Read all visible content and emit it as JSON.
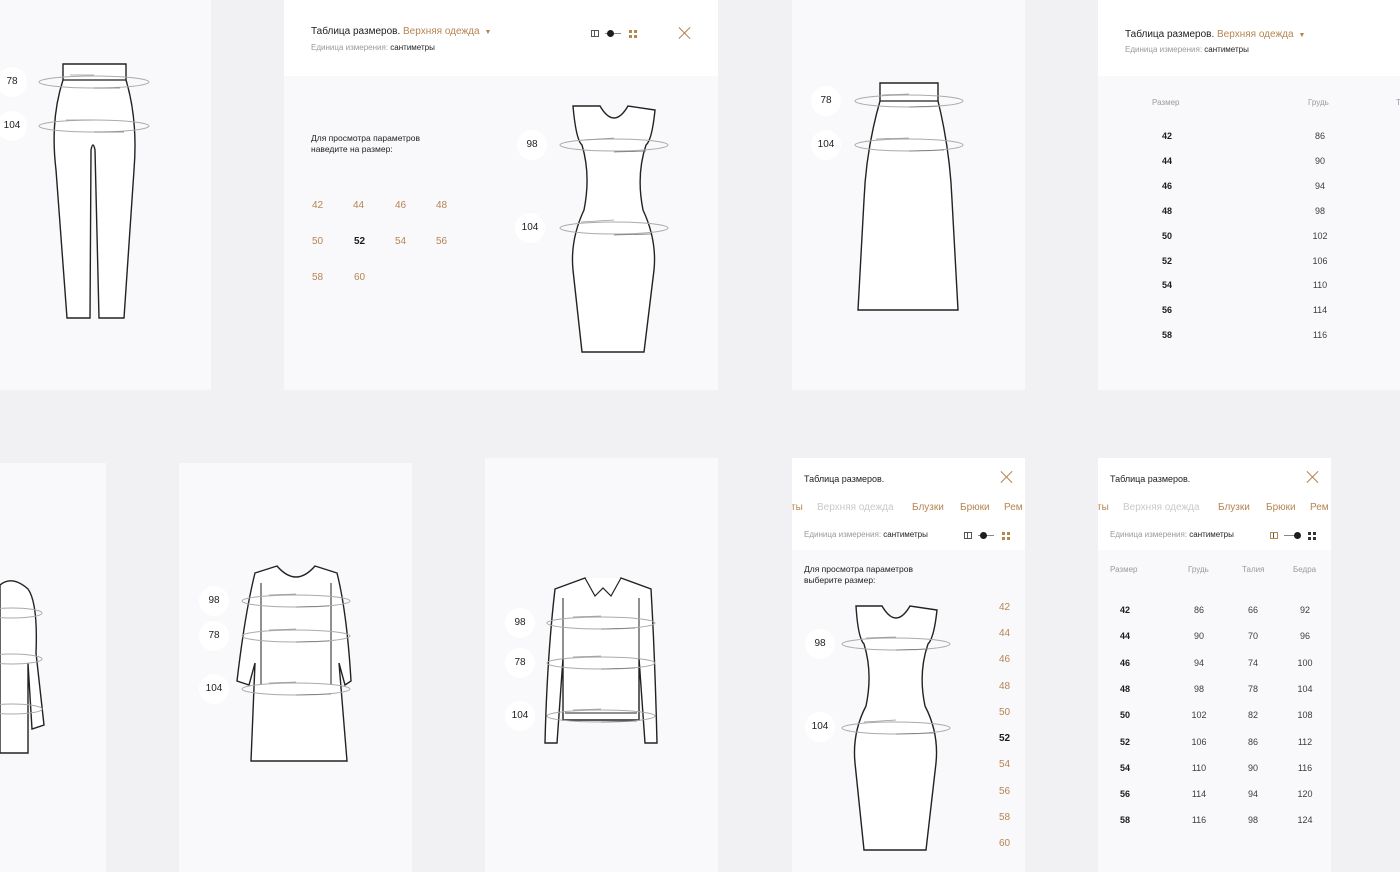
{
  "colors": {
    "accent": "#b58552",
    "page_bg": "#f1f1f3",
    "card_bg": "#f9f9fb",
    "header_bg": "#ffffff",
    "text": "#1d1d1f",
    "muted": "#9a9aa0"
  },
  "pants_card": {
    "badges": [
      "78",
      "104"
    ]
  },
  "popup_desktop": {
    "title": "Таблица размеров.",
    "category": "Верхняя одежда",
    "unit_label": "Единица измерения:",
    "unit_value": "сантиметры",
    "hint": "Для просмотра параметров наведите на размер:",
    "sizes": [
      "42",
      "44",
      "46",
      "48",
      "50",
      "52",
      "54",
      "56",
      "58",
      "60"
    ],
    "selected_size": "52",
    "badges": [
      "98",
      "104"
    ]
  },
  "skirt_card": {
    "badges": [
      "78",
      "104"
    ]
  },
  "table_card_desktop": {
    "title": "Таблица размеров.",
    "category": "Верхняя одежда",
    "unit_label": "Единица измерения:",
    "unit_value": "сантиметры",
    "headers": [
      "Размер",
      "Грудь"
    ],
    "rows": [
      [
        "42",
        "86"
      ],
      [
        "44",
        "90"
      ],
      [
        "46",
        "94"
      ],
      [
        "48",
        "98"
      ],
      [
        "50",
        "102"
      ],
      [
        "52",
        "106"
      ],
      [
        "54",
        "110"
      ],
      [
        "56",
        "114"
      ],
      [
        "58",
        "116"
      ]
    ]
  },
  "dress_card": {
    "badges": [
      "98",
      "78",
      "104"
    ]
  },
  "shirt_card": {
    "badges": [
      "98",
      "78",
      "104"
    ]
  },
  "mobile_picker": {
    "title": "Таблица размеров.",
    "tabs": [
      "ты",
      "Верхняя одежда",
      "Блузки",
      "Брюки",
      "Рем"
    ],
    "unit_label": "Единица измерения:",
    "unit_value": "сантиметры",
    "hint": "Для просмотра параметров выберите размер:",
    "sizes": [
      "42",
      "44",
      "46",
      "48",
      "50",
      "52",
      "54",
      "56",
      "58",
      "60"
    ],
    "selected_size": "52",
    "badges": [
      "98",
      "104"
    ]
  },
  "mobile_table": {
    "title": "Таблица размеров.",
    "tabs": [
      "ты",
      "Верхняя одежда",
      "Блузки",
      "Брюки",
      "Рем"
    ],
    "unit_label": "Единица измерения:",
    "unit_value": "сантиметры",
    "headers": [
      "Размер",
      "Грудь",
      "Талия",
      "Бедра"
    ],
    "rows": [
      [
        "42",
        "86",
        "66",
        "92"
      ],
      [
        "44",
        "90",
        "70",
        "96"
      ],
      [
        "46",
        "94",
        "74",
        "100"
      ],
      [
        "48",
        "98",
        "78",
        "104"
      ],
      [
        "50",
        "102",
        "82",
        "108"
      ],
      [
        "52",
        "106",
        "86",
        "112"
      ],
      [
        "54",
        "110",
        "90",
        "116"
      ],
      [
        "56",
        "114",
        "94",
        "120"
      ],
      [
        "58",
        "116",
        "98",
        "124"
      ]
    ]
  }
}
